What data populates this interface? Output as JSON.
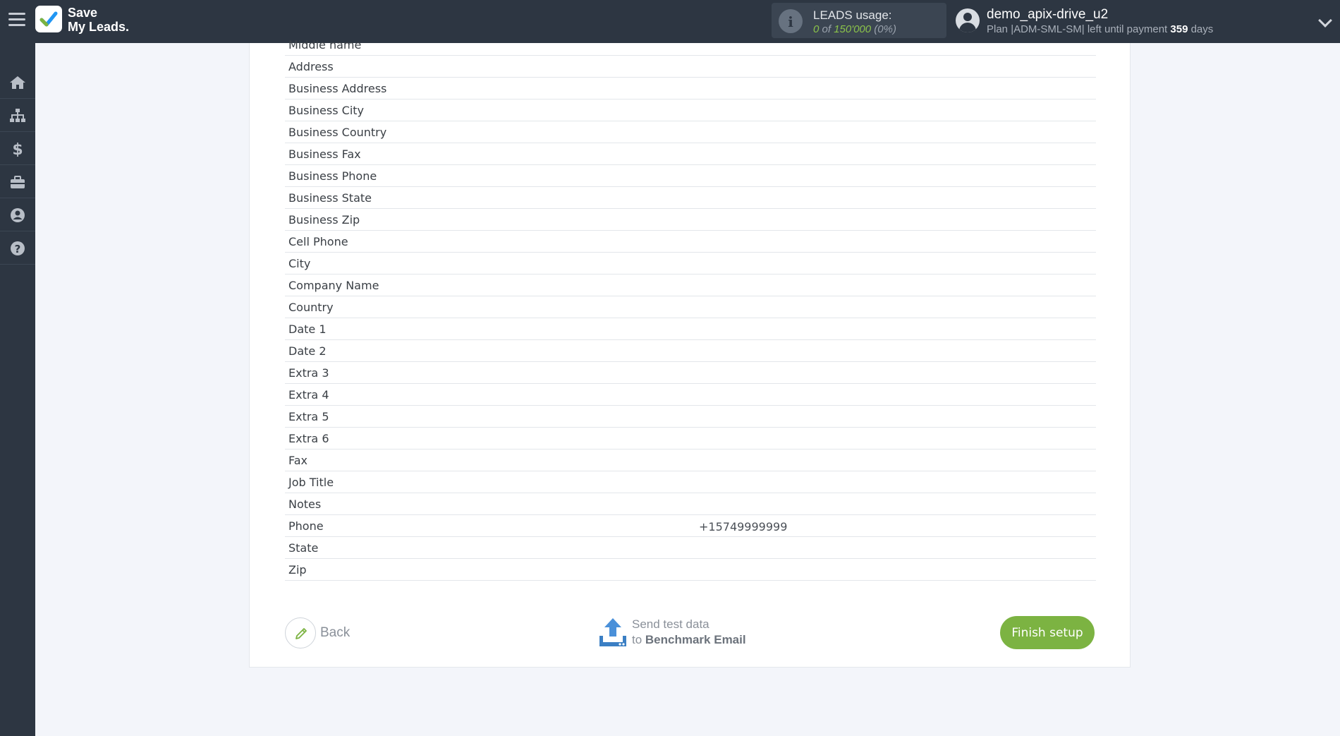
{
  "app": {
    "logo_line1": "Save",
    "logo_line2": "My Leads",
    "logo_dot": ".",
    "brand_color": "#7cb342"
  },
  "usage": {
    "title": "LEADS usage:",
    "used": "0",
    "of_text": " of ",
    "limit": "150'000",
    "percent": "(0%)"
  },
  "user": {
    "name": "demo_apix-drive_u2",
    "plan_prefix": "Plan |ADM-SML-SM| left until payment ",
    "days": "359",
    "days_suffix": " days"
  },
  "sidebar": {
    "items": [
      {
        "icon": "home-icon"
      },
      {
        "icon": "sitemap-icon"
      },
      {
        "icon": "dollar-icon"
      },
      {
        "icon": "briefcase-icon"
      },
      {
        "icon": "user-circle-icon"
      },
      {
        "icon": "help-icon"
      }
    ]
  },
  "fields": [
    {
      "name": "Middle name",
      "value": ""
    },
    {
      "name": "Address",
      "value": ""
    },
    {
      "name": "Business Address",
      "value": ""
    },
    {
      "name": "Business City",
      "value": ""
    },
    {
      "name": "Business Country",
      "value": ""
    },
    {
      "name": "Business Fax",
      "value": ""
    },
    {
      "name": "Business Phone",
      "value": ""
    },
    {
      "name": "Business State",
      "value": ""
    },
    {
      "name": "Business Zip",
      "value": ""
    },
    {
      "name": "Cell Phone",
      "value": ""
    },
    {
      "name": "City",
      "value": ""
    },
    {
      "name": "Company Name",
      "value": ""
    },
    {
      "name": "Country",
      "value": ""
    },
    {
      "name": "Date 1",
      "value": ""
    },
    {
      "name": "Date 2",
      "value": ""
    },
    {
      "name": "Extra 3",
      "value": ""
    },
    {
      "name": "Extra 4",
      "value": ""
    },
    {
      "name": "Extra 5",
      "value": ""
    },
    {
      "name": "Extra 6",
      "value": ""
    },
    {
      "name": "Fax",
      "value": ""
    },
    {
      "name": "Job Title",
      "value": ""
    },
    {
      "name": "Notes",
      "value": ""
    },
    {
      "name": "Phone",
      "value": "+15749999999"
    },
    {
      "name": "State",
      "value": ""
    },
    {
      "name": "Zip",
      "value": ""
    }
  ],
  "actions": {
    "back_label": "Back",
    "send_line1": "Send test data",
    "send_to": "to ",
    "send_target": "Benchmark Email",
    "finish_label": "Finish setup"
  }
}
